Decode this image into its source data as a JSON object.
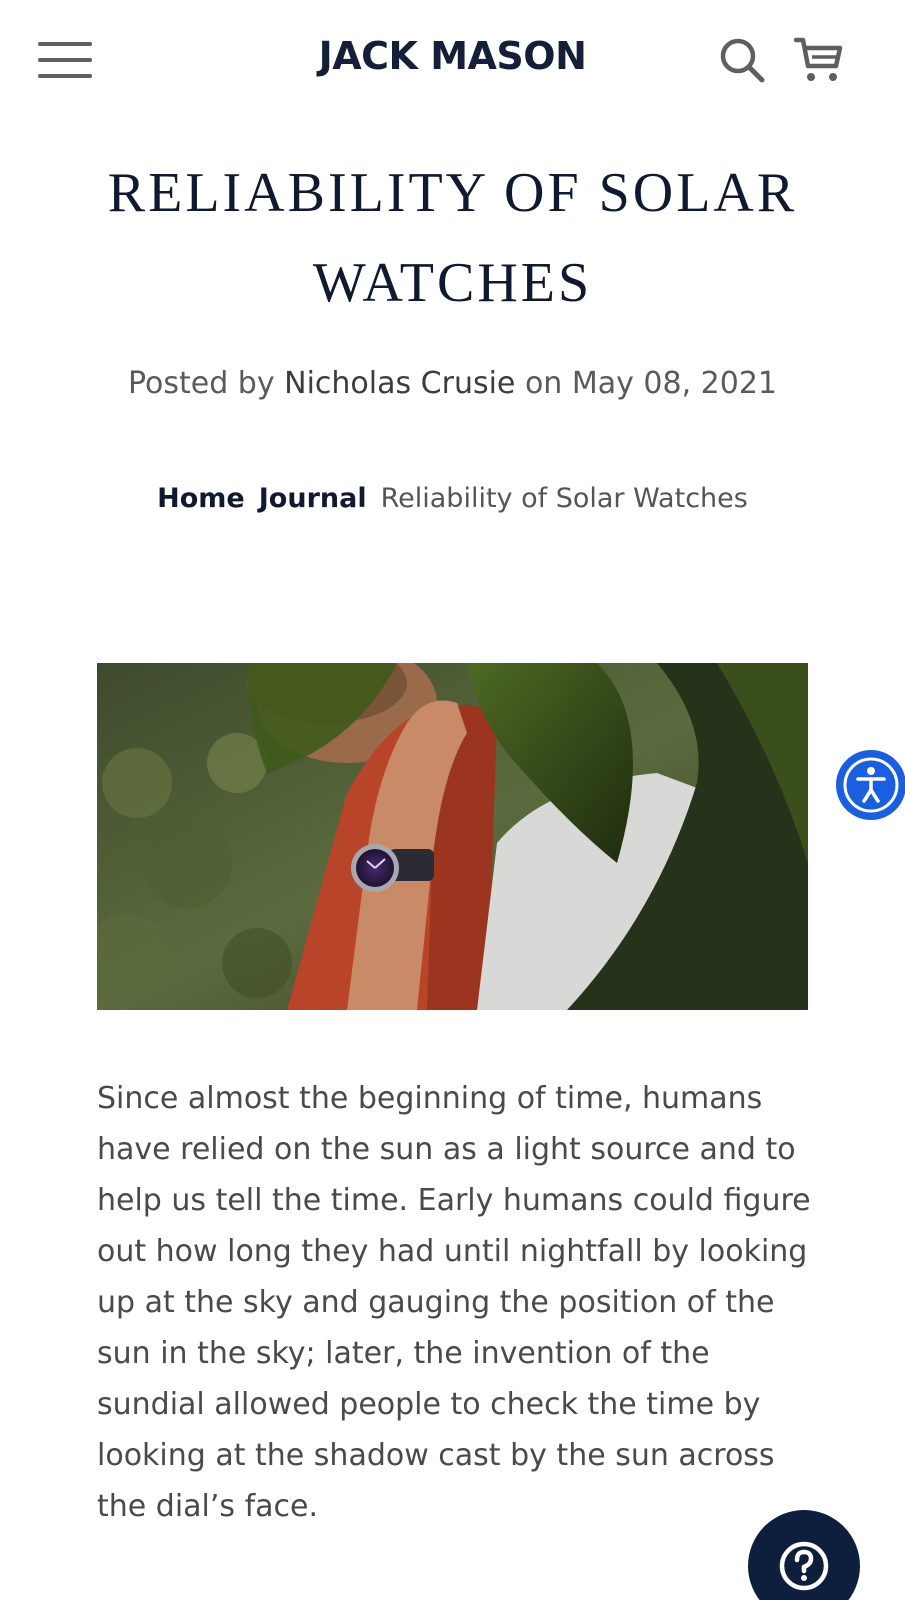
{
  "header": {
    "logo": "JACK MASON",
    "menu_icon": "hamburger-menu-icon",
    "search_icon": "search-icon",
    "cart_icon": "cart-icon"
  },
  "article": {
    "title": "RELIABILITY OF SOLAR WATCHES",
    "posted_prefix": "Posted by",
    "author": "Nicholas Crusie",
    "posted_on": "on",
    "date": "May 08, 2021",
    "body": "Since almost the beginning of time, humans have relied on the sun as a light source and to help us tell the time. Early humans could figure out how long they had until nightfall by looking up at the sky and gauging the position of the sun in the sky; later, the invention of the sundial allowed people to check the time by looking at the shadow cast by the sun across the dial’s face."
  },
  "breadcrumb": {
    "home": "Home",
    "journal": "Journal",
    "current": "Reliability of Solar Watches"
  },
  "floating": {
    "accessibility_icon": "accessibility-icon",
    "help_icon": "help-question-icon"
  },
  "colors": {
    "brand_navy": "#152038",
    "accessibility_blue": "#1a5fe0",
    "help_navy": "#0e1f3d",
    "text_gray": "#4a4a4a"
  }
}
